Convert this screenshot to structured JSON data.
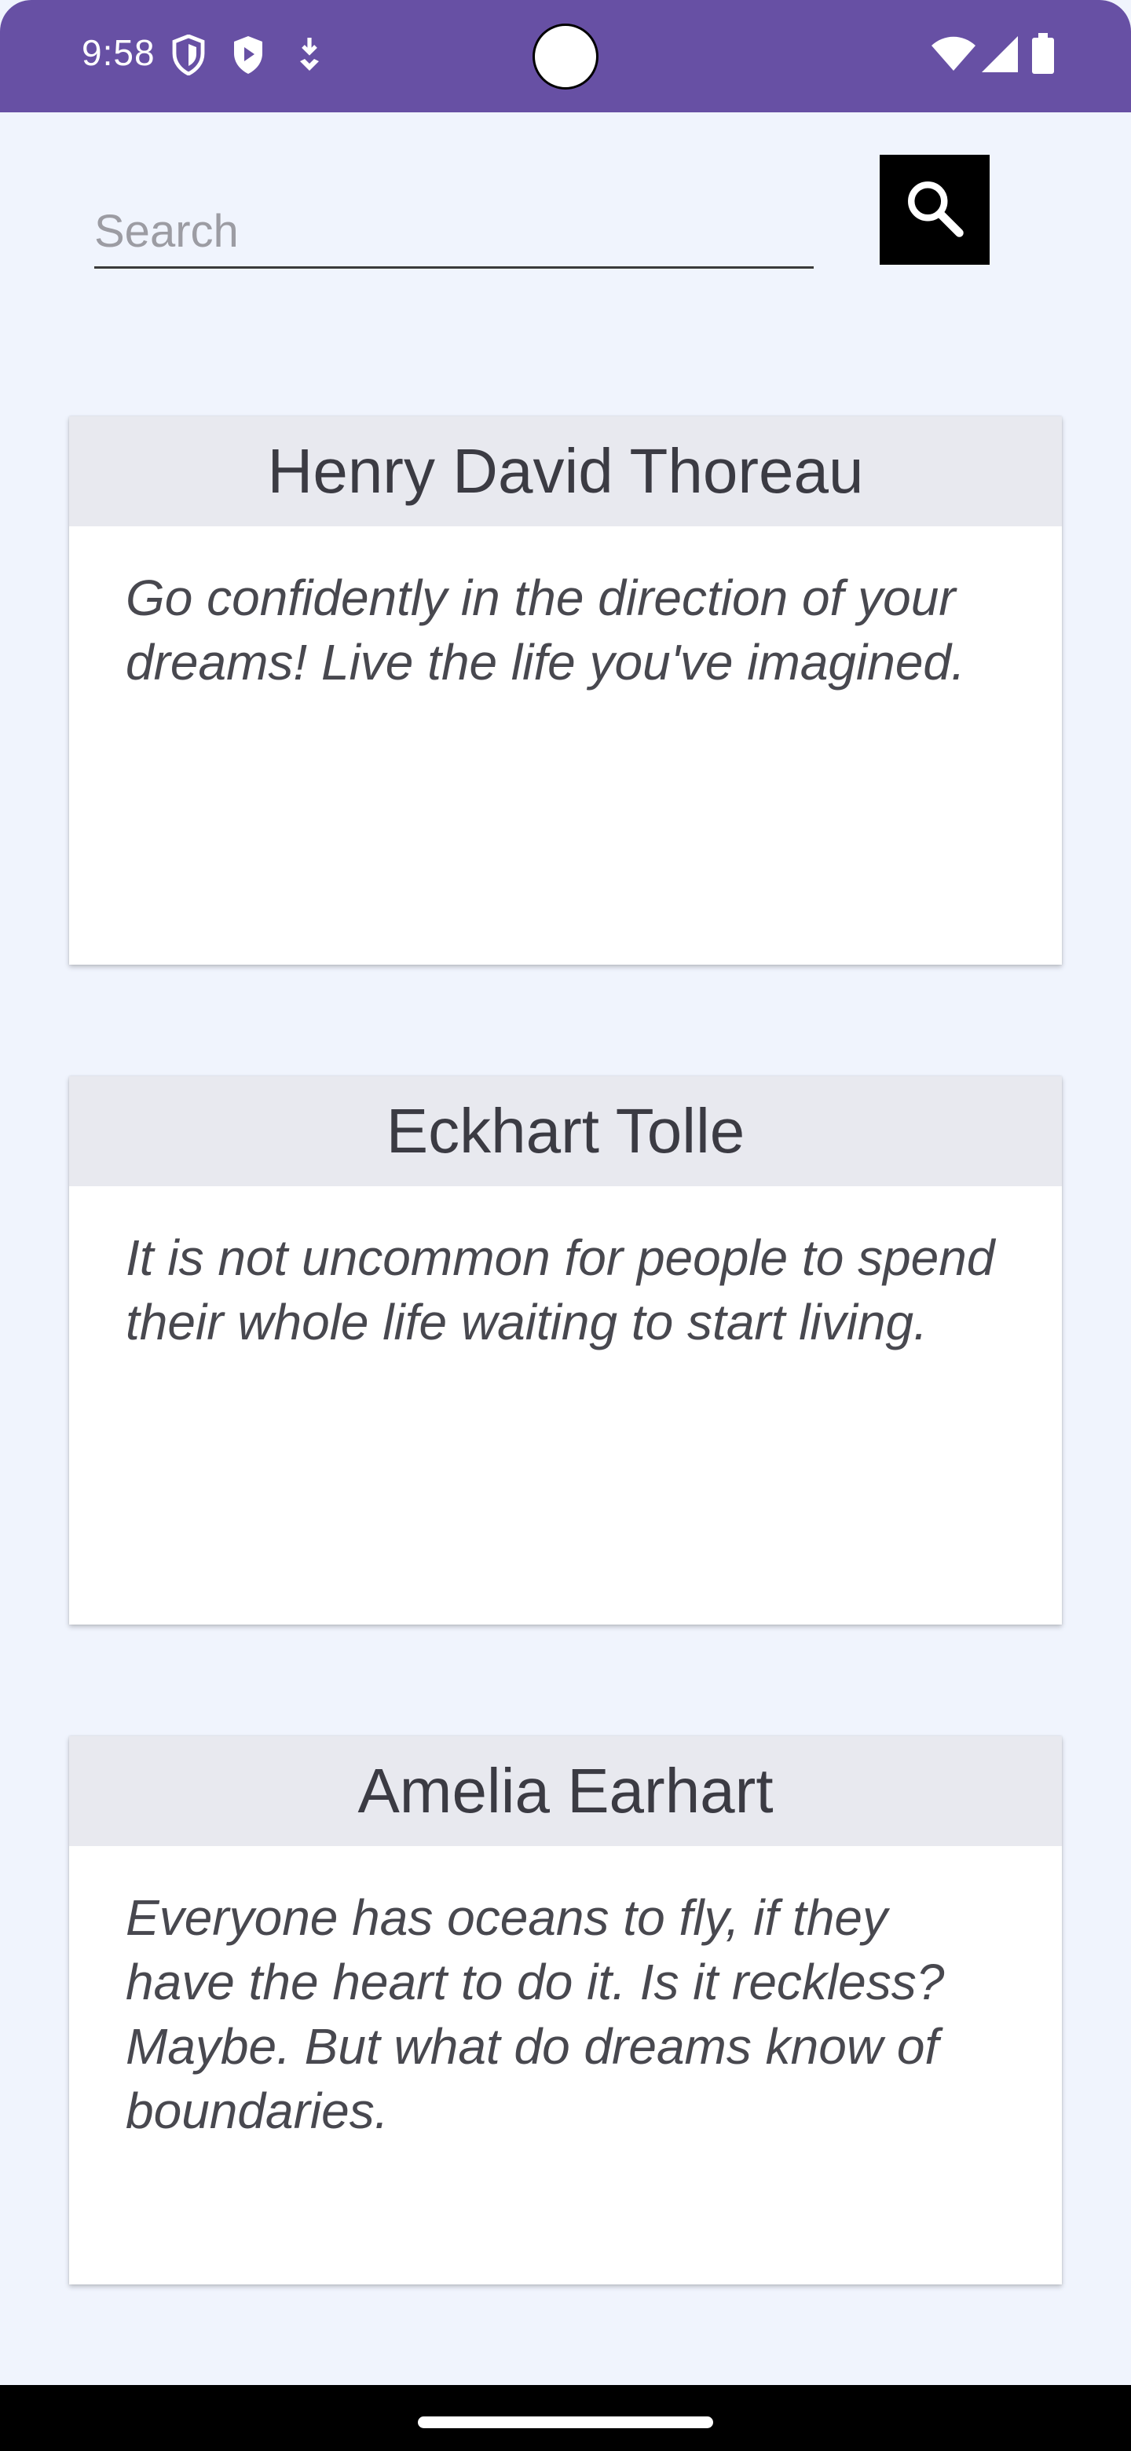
{
  "status_bar": {
    "time": "9:58",
    "icons": [
      "shield-icon",
      "play-protect-icon",
      "download-icon",
      "wifi-icon",
      "cellular-signal-icon",
      "battery-icon"
    ],
    "background": "#6750a4"
  },
  "search": {
    "placeholder": "Search",
    "value": "",
    "button_icon": "search-icon"
  },
  "quotes": [
    {
      "author": "Henry David Thoreau",
      "text": "Go confidently in the direction of your dreams! Live the life you've imagined."
    },
    {
      "author": "Eckhart Tolle",
      "text": "It is not uncommon for people to spend their whole life waiting to start living."
    },
    {
      "author": "Amelia Earhart",
      "text": "Everyone has oceans to fly, if they have the heart to do it. Is it reckless? Maybe. But what do dreams know of boundaries."
    }
  ],
  "colors": {
    "page_background": "#f0f4fd",
    "card_header": "#e8e9ef",
    "card_body": "#ffffff",
    "search_button": "#000000"
  }
}
